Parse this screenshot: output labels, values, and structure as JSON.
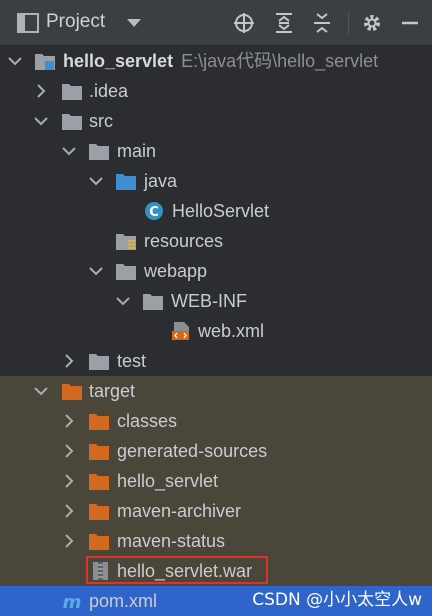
{
  "header": {
    "title": "Project"
  },
  "tree": {
    "root": {
      "name": "hello_servlet",
      "path": "E:\\java代码\\hello_servlet"
    },
    "idea": ".idea",
    "src": "src",
    "main": "main",
    "java": "java",
    "helloservlet": "HelloServlet",
    "resources": "resources",
    "webapp": "webapp",
    "webinf": "WEB-INF",
    "webxml": "web.xml",
    "test": "test",
    "target": "target",
    "classes": "classes",
    "generated": "generated-sources",
    "target_hello": "hello_servlet",
    "maven_archiver": "maven-archiver",
    "maven_status": "maven-status",
    "war": "hello_servlet.war",
    "pom": "pom.xml"
  },
  "watermark": "CSDN @小小太空人w",
  "colors": {
    "panel_bg": "#2b2d30",
    "excluded_bg": "#4a4639",
    "selected_bg": "#2f65ca",
    "folder_gray": "#9aa0a6",
    "folder_blue": "#3d8fd1",
    "folder_orange": "#d2691e",
    "highlight_box": "#e0312b"
  }
}
